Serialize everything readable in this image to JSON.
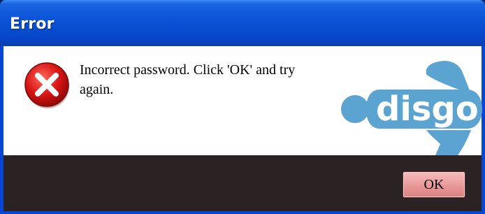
{
  "dialog": {
    "title": "Error",
    "message": "Incorrect password. Click 'OK' and try again.",
    "ok_label": "OK",
    "icon": "error-icon",
    "logo_text": "disgo"
  },
  "colors": {
    "titlebar": "#0b54d8",
    "error_red": "#d10f0f",
    "logo_blue": "#5ba3d1",
    "footer": "#2b2323",
    "button": "#e89898"
  }
}
